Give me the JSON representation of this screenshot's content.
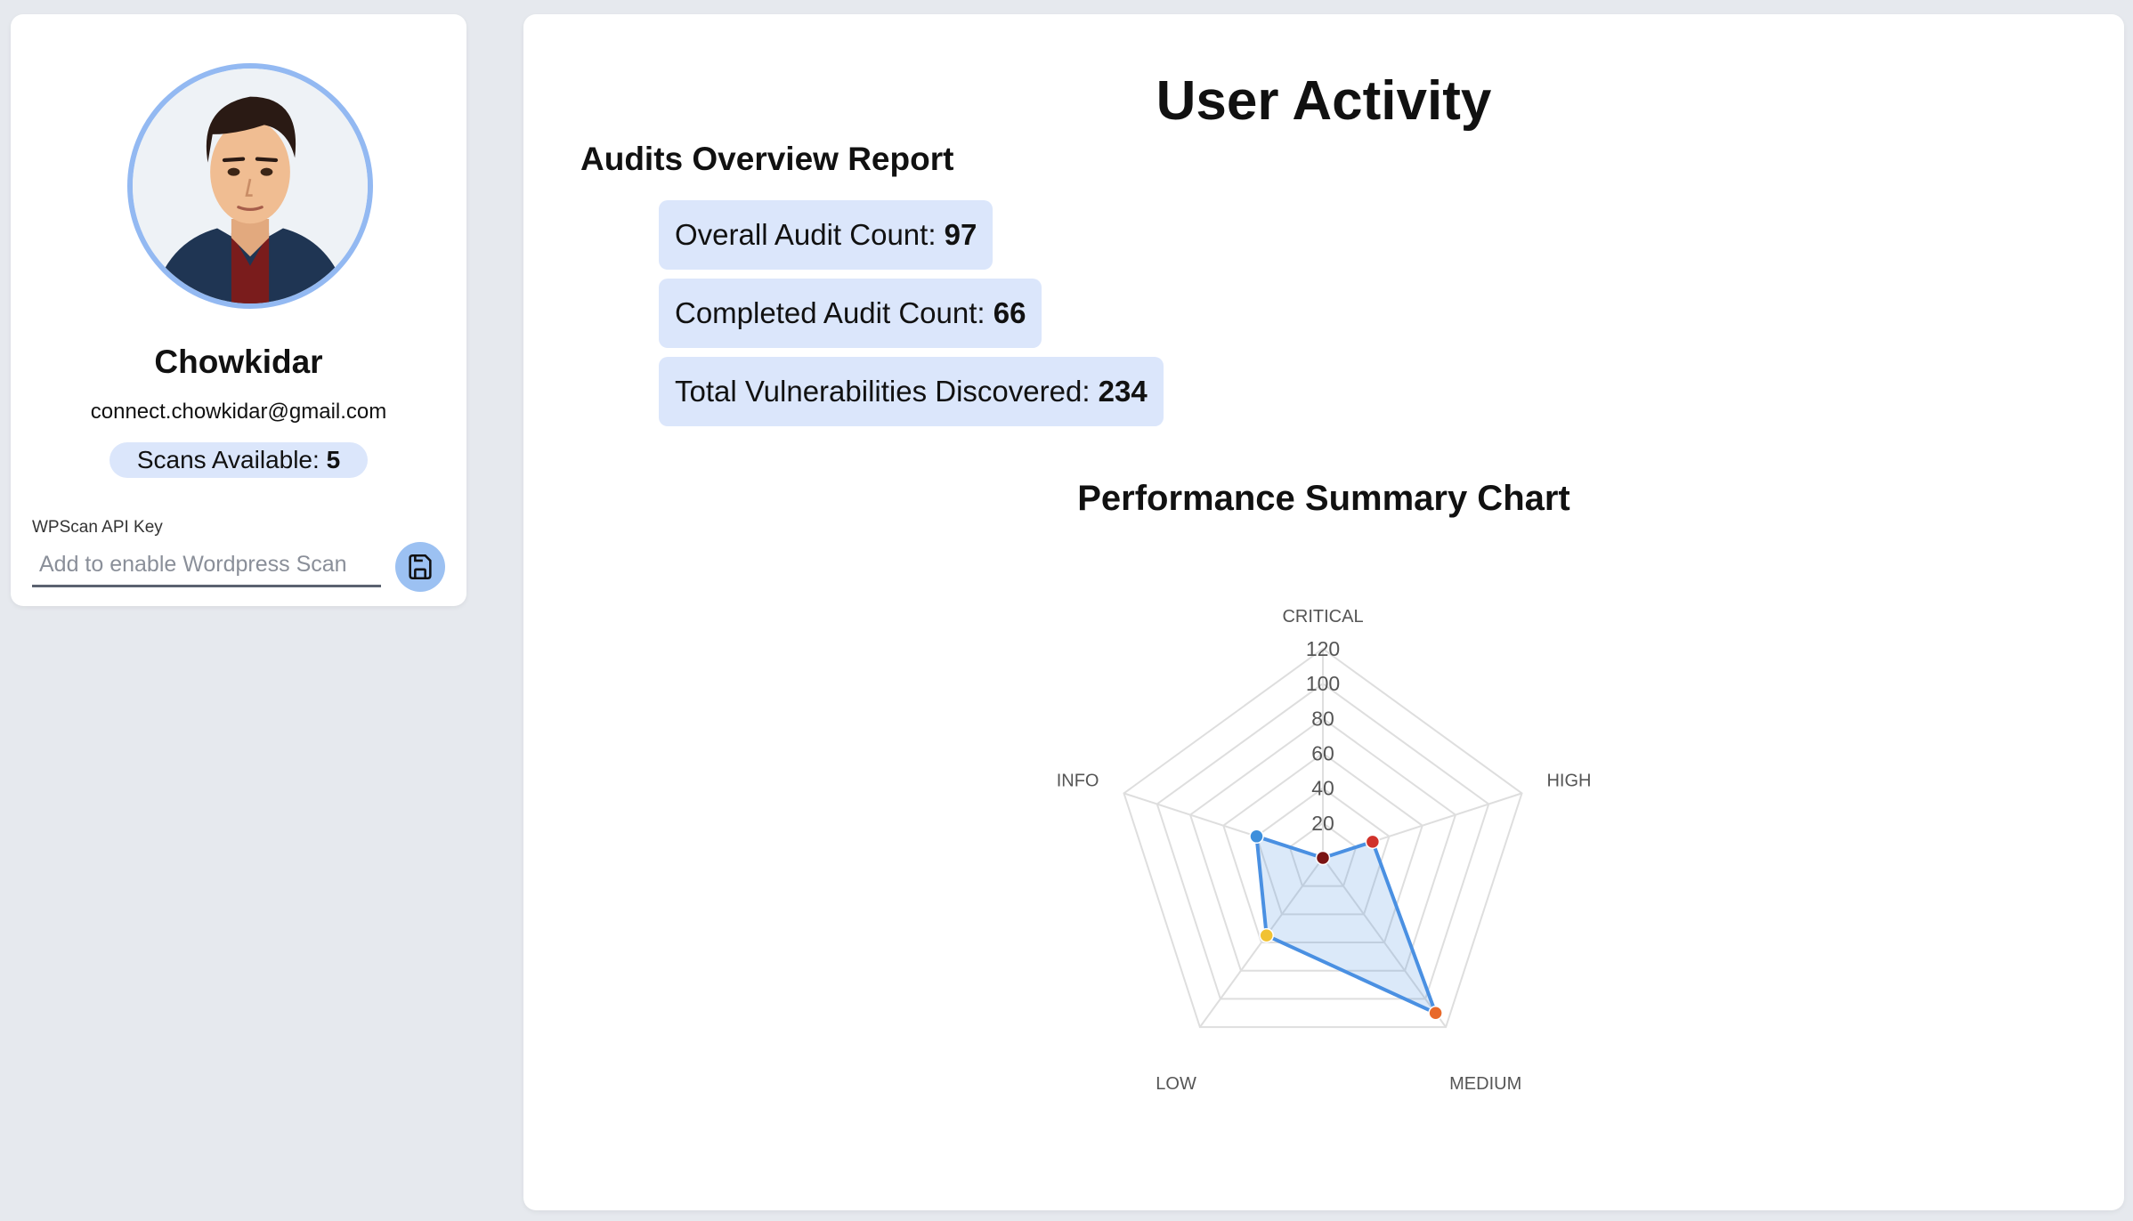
{
  "profile": {
    "name": "Chowkidar",
    "email": "connect.chowkidar@gmail.com",
    "scans_label": "Scans Available:",
    "scans_value": "5",
    "api_key_label": "WPScan API Key",
    "api_key_placeholder": "Add to enable Wordpress Scan",
    "save_icon": "save-icon"
  },
  "main": {
    "title": "User Activity",
    "section_title": "Audits Overview Report",
    "stats": [
      {
        "label": "Overall Audit Count:",
        "value": "97"
      },
      {
        "label": "Completed Audit Count:",
        "value": "66"
      },
      {
        "label": "Total Vulnerabilities Discovered:",
        "value": "234"
      }
    ],
    "chart_title": "Performance Summary Chart"
  },
  "colors": {
    "accent": "#4a90e2",
    "fill": "rgba(74,144,226,0.2)",
    "critical": "#7b1414",
    "high": "#d0322b",
    "medium": "#e8692a",
    "low": "#f1c232",
    "info": "#3d8fdc"
  },
  "chart_data": {
    "type": "radar",
    "title": "Performance Summary Chart",
    "categories": [
      "CRITICAL",
      "HIGH",
      "MEDIUM",
      "LOW",
      "INFO"
    ],
    "values": [
      0,
      30,
      110,
      55,
      40
    ],
    "r_ticks": [
      20,
      40,
      60,
      80,
      100,
      120
    ],
    "r_range": [
      0,
      120
    ],
    "grid": true,
    "point_colors": [
      "#7b1414",
      "#d0322b",
      "#e8692a",
      "#f1c232",
      "#3d8fdc"
    ]
  }
}
